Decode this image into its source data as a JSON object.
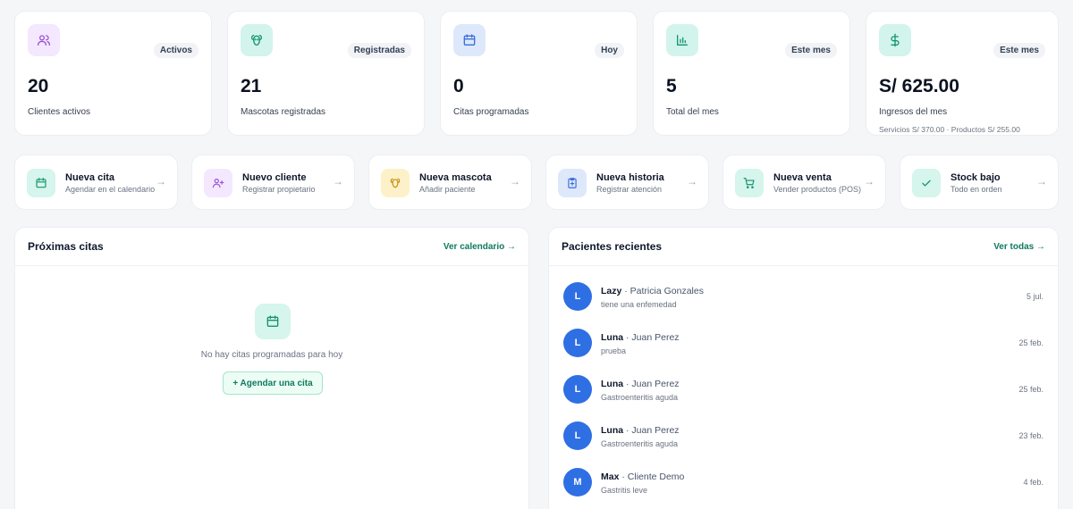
{
  "stats": [
    {
      "badge": "Activos",
      "value": "20",
      "label": "Clientes activos",
      "icon": "users-icon"
    },
    {
      "badge": "Registradas",
      "value": "21",
      "label": "Mascotas registradas",
      "icon": "paw-icon"
    },
    {
      "badge": "Hoy",
      "value": "0",
      "label": "Citas programadas",
      "icon": "calendar-icon"
    },
    {
      "badge": "Este mes",
      "value": "5",
      "label": "Total del mes",
      "icon": "bar-chart-icon"
    },
    {
      "badge": "Este mes",
      "value": "S/ 625.00",
      "label": "Ingresos del mes",
      "sub": "Servicios S/ 370.00 · Productos S/ 255.00",
      "icon": "dollar-icon"
    }
  ],
  "actions": [
    {
      "title": "Nueva cita",
      "desc": "Agendar en el calendario",
      "icon": "calendar-icon"
    },
    {
      "title": "Nuevo cliente",
      "desc": "Registrar propietario",
      "icon": "user-plus-icon"
    },
    {
      "title": "Nueva mascota",
      "desc": "Añadir paciente",
      "icon": "paw-icon"
    },
    {
      "title": "Nueva historia",
      "desc": "Registrar atención",
      "icon": "clipboard-plus-icon"
    },
    {
      "title": "Nueva venta",
      "desc": "Vender productos (POS)",
      "icon": "cart-icon"
    },
    {
      "title": "Stock bajo",
      "desc": "Todo en orden",
      "icon": "check-icon"
    }
  ],
  "appointments": {
    "title": "Próximas citas",
    "link": "Ver calendario →",
    "empty_text": "No hay citas programadas para hoy",
    "button": "+ Agendar una cita"
  },
  "recent": {
    "title": "Pacientes recientes",
    "link": "Ver todas →",
    "patients": [
      {
        "initial": "L",
        "pet": "Lazy",
        "owner": "· Patricia Gonzales",
        "note": "tiene una enfemedad",
        "date": "5 jul."
      },
      {
        "initial": "L",
        "pet": "Luna",
        "owner": "· Juan Perez",
        "note": "prueba",
        "date": "25 feb."
      },
      {
        "initial": "L",
        "pet": "Luna",
        "owner": "· Juan Perez",
        "note": "Gastroenteritis aguda",
        "date": "25 feb."
      },
      {
        "initial": "L",
        "pet": "Luna",
        "owner": "· Juan Perez",
        "note": "Gastroenteritis aguda",
        "date": "23 feb."
      },
      {
        "initial": "M",
        "pet": "Max",
        "owner": "· Cliente Demo",
        "note": "Gastritis leve",
        "date": "4 feb."
      }
    ]
  },
  "colors": {
    "accent": "#0f7a5e",
    "avatar": "#2f6fe4"
  }
}
